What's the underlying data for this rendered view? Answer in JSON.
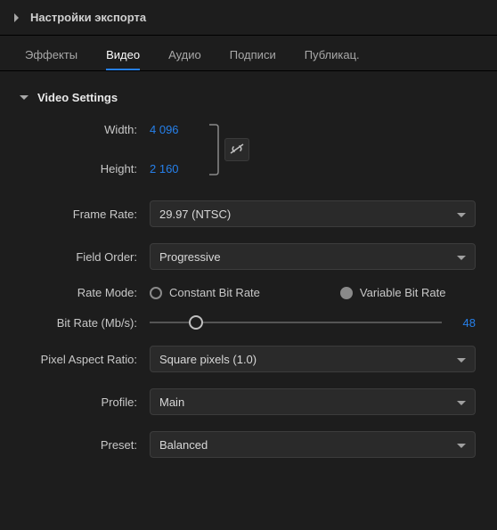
{
  "header": {
    "export_settings": "Настройки экспорта"
  },
  "tabs": {
    "effects": "Эффекты",
    "video": "Видео",
    "audio": "Аудио",
    "captions": "Подписи",
    "publish": "Публикац."
  },
  "video": {
    "section_title": "Video Settings",
    "width_label": "Width:",
    "width_value": "4 096",
    "height_label": "Height:",
    "height_value": "2 160",
    "frame_rate_label": "Frame Rate:",
    "frame_rate_value": "29.97 (NTSC)",
    "field_order_label": "Field Order:",
    "field_order_value": "Progressive",
    "rate_mode_label": "Rate Mode:",
    "rate_mode_cbr": "Constant Bit Rate",
    "rate_mode_vbr": "Variable Bit Rate",
    "bit_rate_label": "Bit Rate (Mb/s):",
    "bit_rate_value": "48",
    "bit_rate_pct": 16,
    "par_label": "Pixel Aspect Ratio:",
    "par_value": "Square pixels (1.0)",
    "profile_label": "Profile:",
    "profile_value": "Main",
    "preset_label": "Preset:",
    "preset_value": "Balanced"
  }
}
